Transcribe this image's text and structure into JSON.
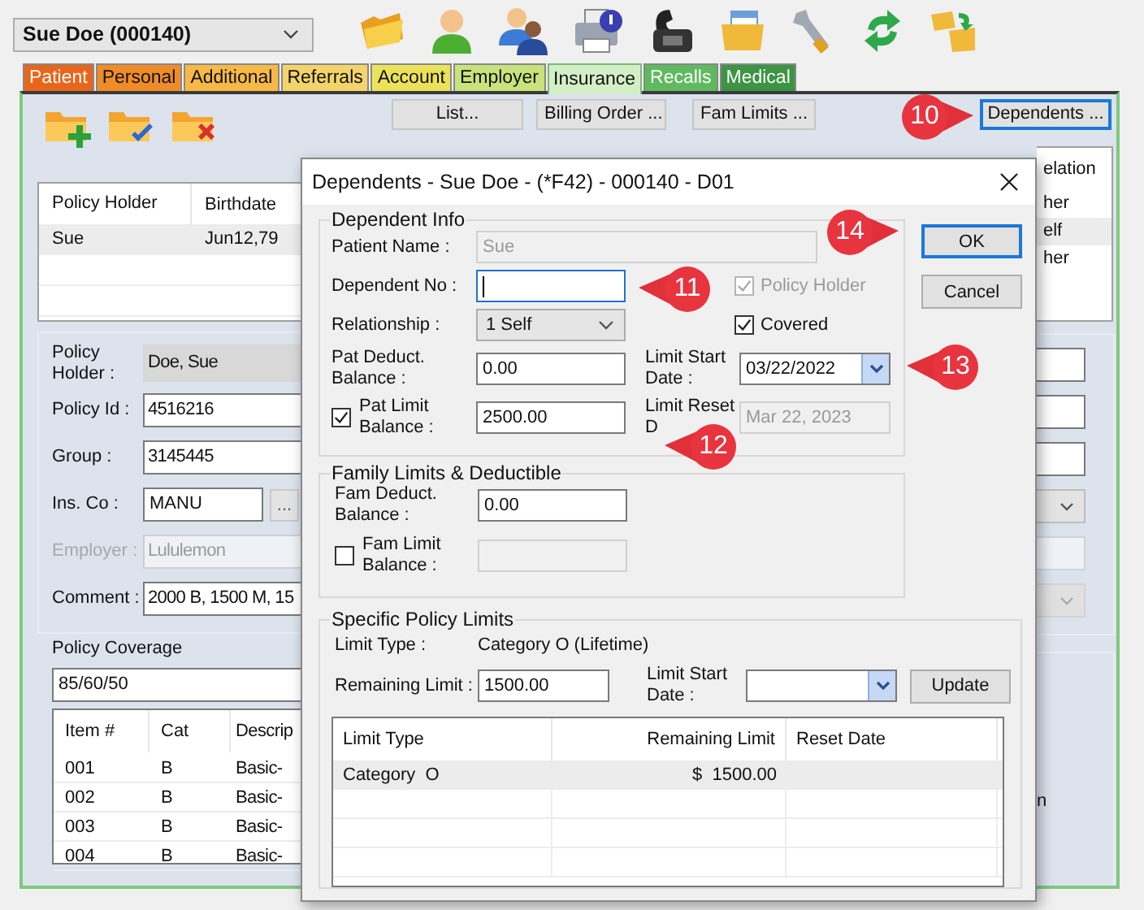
{
  "patient_selector": {
    "value": "Sue Doe (000140)"
  },
  "tabs": [
    {
      "label": "Patient",
      "color": "#e8661c",
      "selected": false
    },
    {
      "label": "Personal",
      "color": "#f08c28",
      "selected": false
    },
    {
      "label": "Additional",
      "color": "#f7b946",
      "selected": false
    },
    {
      "label": "Referrals",
      "color": "#f4d46a",
      "selected": false
    },
    {
      "label": "Account",
      "color": "#ece25a",
      "selected": false
    },
    {
      "label": "Employer",
      "color": "#c8e37c",
      "selected": false
    },
    {
      "label": "Insurance",
      "color": "#d4efc6",
      "selected": true
    },
    {
      "label": "Recalls",
      "color": "#5fb95f",
      "selected": false
    },
    {
      "label": "Medical",
      "color": "#3c9444",
      "selected": false
    }
  ],
  "panel_buttons": [
    {
      "label": "List...",
      "focused": false
    },
    {
      "label": "Billing Order ...",
      "focused": false
    },
    {
      "label": "Fam Limits ...",
      "focused": false
    },
    {
      "label": "Dependents ...",
      "focused": true
    }
  ],
  "holders_list": {
    "columns": [
      "Policy Holder",
      "Birthdate"
    ],
    "rows": [
      {
        "cells": [
          "Sue",
          "Jun12,79"
        ],
        "selected": true
      }
    ]
  },
  "policy_form": [
    {
      "label": "Policy Holder :",
      "value": "Doe, Sue",
      "kind": "readonly",
      "disabled": false
    },
    {
      "label": "Policy Id :",
      "value": "4516216",
      "kind": "text",
      "disabled": false
    },
    {
      "label": "Group :",
      "value": "3145445",
      "kind": "text",
      "disabled": false
    },
    {
      "label": "Ins. Co :",
      "value": "MANU",
      "kind": "lookup",
      "button": "...",
      "disabled": false
    },
    {
      "label": "Employer :",
      "value": "Lululemon",
      "kind": "text",
      "disabled": true
    },
    {
      "label": "Comment :",
      "value": "2000 B, 1500 M, 15",
      "kind": "text",
      "disabled": false
    }
  ],
  "policy_coverage": {
    "label": "Policy Coverage",
    "value": "85/60/50",
    "columns": [
      "Item #",
      "Cat",
      "Descrip"
    ],
    "rows": [
      [
        "001",
        "B",
        "Basic-"
      ],
      [
        "002",
        "B",
        "Basic-"
      ],
      [
        "003",
        "B",
        "Basic-"
      ],
      [
        "004",
        "B",
        "Basic-"
      ]
    ]
  },
  "dependents_list": {
    "column": "elation",
    "rows": [
      {
        "text": "her",
        "selected": false
      },
      {
        "text": "elf",
        "selected": true
      },
      {
        "text": "her",
        "selected": false
      }
    ]
  },
  "right_fields": [
    {
      "kind": "text",
      "disabled": false
    },
    {
      "kind": "text",
      "disabled": false
    },
    {
      "kind": "text",
      "disabled": false
    },
    {
      "kind": "dropdown",
      "disabled": false
    },
    {
      "kind": "text",
      "disabled": true
    },
    {
      "kind": "dropdown",
      "disabled": true
    }
  ],
  "right_lower_text": "n",
  "dialog": {
    "title": "Dependents - Sue Doe - (*F42) - 000140 - D01",
    "dependent_info": {
      "legend": "Dependent Info",
      "patient_name": {
        "label": "Patient Name :",
        "value": "Sue",
        "disabled": true
      },
      "dependent_no": {
        "label": "Dependent No :",
        "focused": true
      },
      "relationship": {
        "label": "Relationship :",
        "value": "1 Self"
      },
      "pat_deduct_balance": {
        "label": "Pat Deduct. Balance :",
        "value": "0.00"
      },
      "pat_limit_balance": {
        "label": "Pat Limit Balance :",
        "value": "2500.00",
        "checked": true
      },
      "policy_holder": {
        "label": "Policy Holder",
        "checked": true,
        "disabled": true
      },
      "covered": {
        "label": "Covered",
        "checked": true,
        "disabled": false
      },
      "limit_start_date": {
        "label": "Limit Start Date :",
        "value": "03/22/2022"
      },
      "limit_reset_date": {
        "label_lines": [
          "Limit Reset",
          "D"
        ],
        "value": "Mar 22, 2023",
        "disabled": true
      }
    },
    "buttons": [
      {
        "label": "OK",
        "default": true
      },
      {
        "label": "Cancel",
        "default": false
      }
    ],
    "family": {
      "legend": "Family Limits & Deductible",
      "fam_deduct_balance": {
        "label": "Fam Deduct. Balance :",
        "value": "0.00"
      },
      "fam_limit_balance": {
        "label": "Fam Limit Balance :",
        "checked": false,
        "disabled": true
      }
    },
    "specific": {
      "legend": "Specific Policy Limits",
      "limit_type": {
        "label": "Limit Type :",
        "value": "Category O (Lifetime)"
      },
      "remaining_limit": {
        "label": "Remaining Limit :",
        "value": "1500.00"
      },
      "limit_start_date": {
        "label": "Limit Start Date :"
      },
      "update_button": "Update",
      "table": {
        "columns": [
          "Limit Type",
          "Remaining Limit",
          "Reset Date"
        ],
        "rows": [
          {
            "cells": [
              "Category  O",
              "$  1500.00"
            ],
            "selected": true
          }
        ]
      }
    }
  },
  "callouts": [
    {
      "number": "10",
      "kind": "right-pointer"
    },
    {
      "number": "11",
      "kind": "left-pointer"
    },
    {
      "number": "12",
      "kind": "left-pointer"
    },
    {
      "number": "13",
      "kind": "left-pointer"
    },
    {
      "number": "14",
      "kind": "right-pointer"
    }
  ]
}
